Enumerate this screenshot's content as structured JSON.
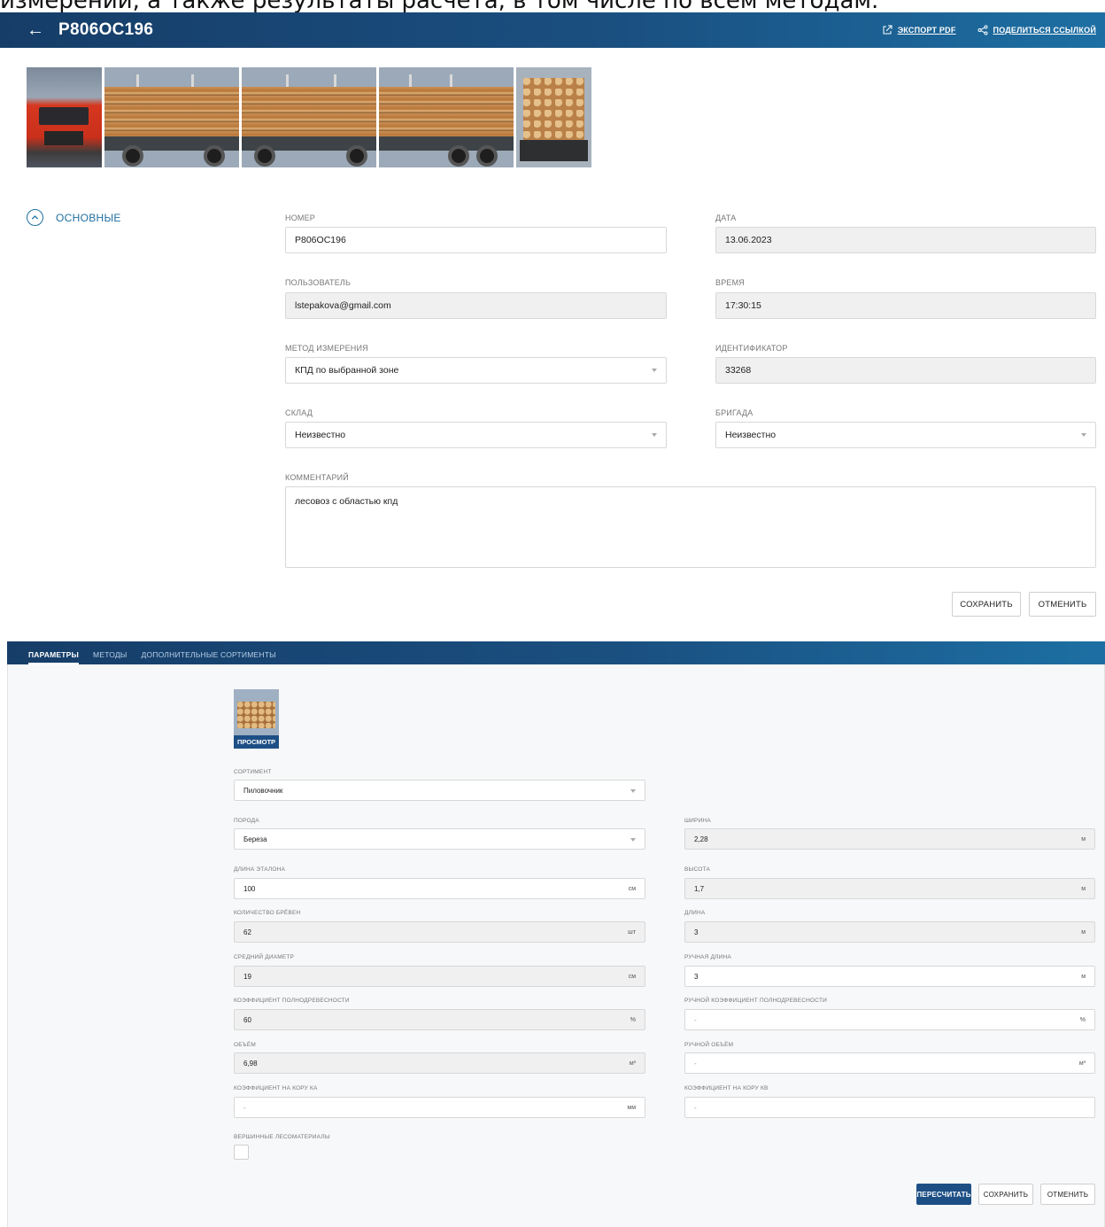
{
  "top_caption": "измерений, а также результаты расчета, в том числе по всем методам.",
  "header": {
    "title": "Р806ОС196",
    "export_pdf": "ЭКСПОРТ PDF",
    "share_link": "ПОДЕЛИТЬСЯ ССЫЛКОЙ"
  },
  "section": {
    "label": "ОСНОВНЫЕ"
  },
  "main_form": {
    "number_label": "НОМЕР",
    "number_value": "Р806ОС196",
    "date_label": "ДАТА",
    "date_value": "13.06.2023",
    "user_label": "ПОЛЬЗОВАТЕЛЬ",
    "user_value": "lstepakova@gmail.com",
    "time_label": "ВРЕМЯ",
    "time_value": "17:30:15",
    "method_label": "МЕТОД ИЗМЕРЕНИЯ",
    "method_value": "КПД по выбранной зоне",
    "id_label": "ИДЕНТИФИКАТОР",
    "id_value": "33268",
    "warehouse_label": "СКЛАД",
    "warehouse_value": "Неизвестно",
    "brigade_label": "БРИГАДА",
    "brigade_value": "Неизвестно",
    "comment_label": "КОММЕНТАРИЙ",
    "comment_value": "лесовоз с областью кпд",
    "save": "СОХРАНИТЬ",
    "cancel": "ОТМЕНИТЬ"
  },
  "tabs": [
    "ПАРАМЕТРЫ",
    "МЕТОДЫ",
    "ДОПОЛНИТЕЛЬНЫЕ СОРТИМЕНТЫ"
  ],
  "params": {
    "view_btn": "ПРОСМОТР",
    "sortiment_label": "СОРТИМЕНТ",
    "sortiment_value": "Пиловочник",
    "breed_label": "ПОРОДА",
    "breed_value": "Береза",
    "width_label": "ШИРИНА",
    "width_value": "2,28",
    "width_unit": "м",
    "ref_length_label": "ДЛИНА ЭТАЛОНА",
    "ref_length_value": "100",
    "ref_length_unit": "см",
    "height_label": "ВЫСОТА",
    "height_value": "1,7",
    "height_unit": "м",
    "logs_label": "КОЛИЧЕСТВО БРЁВЕН",
    "logs_value": "62",
    "logs_unit": "шт",
    "length_label": "ДЛИНА",
    "length_value": "3",
    "length_unit": "м",
    "avg_diam_label": "СРЕДНИЙ ДИАМЕТР",
    "avg_diam_value": "19",
    "avg_diam_unit": "см",
    "manual_length_label": "РУЧНАЯ ДЛИНА",
    "manual_length_value": "3",
    "manual_length_unit": "м",
    "fullness_label": "КОЭФФИЦИЕНТ ПОЛНОДРЕВЕСНОСТИ",
    "fullness_value": "60",
    "fullness_unit": "%",
    "manual_fullness_label": "РУЧНОЙ КОЭФФИЦИЕНТ ПОЛНОДРЕВЕСНОСТИ",
    "manual_fullness_value": "-",
    "manual_fullness_unit": "%",
    "volume_label": "ОБЪЁМ",
    "volume_value": "6,98",
    "volume_unit": "м³",
    "manual_volume_label": "РУЧНОЙ ОБЪЁМ",
    "manual_volume_value": "-",
    "manual_volume_unit": "м³",
    "bark_ka_label": "КОЭФФИЦИЕНТ НА КОРУ КА",
    "bark_ka_value": "-",
    "bark_ka_unit": "мм",
    "bark_kb_label": "КОЭФФИЦИЕНТ НА КОРУ КВ",
    "bark_kb_value": "-",
    "top_wood_label": "ВЕРШИННЫЕ ЛЕСОМАТЕРИАЛЫ",
    "recalc": "ПЕРЕСЧИТАТЬ",
    "save": "СОХРАНИТЬ",
    "cancel": "ОТМЕНИТЬ"
  }
}
